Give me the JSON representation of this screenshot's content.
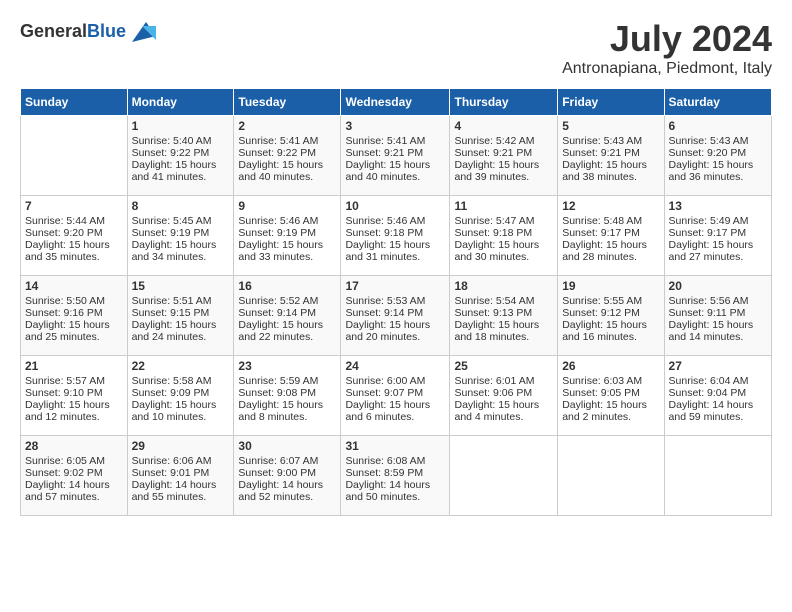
{
  "header": {
    "logo_general": "General",
    "logo_blue": "Blue",
    "month_title": "July 2024",
    "location": "Antronapiana, Piedmont, Italy"
  },
  "days_of_week": [
    "Sunday",
    "Monday",
    "Tuesday",
    "Wednesday",
    "Thursday",
    "Friday",
    "Saturday"
  ],
  "weeks": [
    [
      {
        "day": "",
        "sunrise": "",
        "sunset": "",
        "daylight": ""
      },
      {
        "day": "1",
        "sunrise": "Sunrise: 5:40 AM",
        "sunset": "Sunset: 9:22 PM",
        "daylight": "Daylight: 15 hours and 41 minutes."
      },
      {
        "day": "2",
        "sunrise": "Sunrise: 5:41 AM",
        "sunset": "Sunset: 9:22 PM",
        "daylight": "Daylight: 15 hours and 40 minutes."
      },
      {
        "day": "3",
        "sunrise": "Sunrise: 5:41 AM",
        "sunset": "Sunset: 9:21 PM",
        "daylight": "Daylight: 15 hours and 40 minutes."
      },
      {
        "day": "4",
        "sunrise": "Sunrise: 5:42 AM",
        "sunset": "Sunset: 9:21 PM",
        "daylight": "Daylight: 15 hours and 39 minutes."
      },
      {
        "day": "5",
        "sunrise": "Sunrise: 5:43 AM",
        "sunset": "Sunset: 9:21 PM",
        "daylight": "Daylight: 15 hours and 38 minutes."
      },
      {
        "day": "6",
        "sunrise": "Sunrise: 5:43 AM",
        "sunset": "Sunset: 9:20 PM",
        "daylight": "Daylight: 15 hours and 36 minutes."
      }
    ],
    [
      {
        "day": "7",
        "sunrise": "Sunrise: 5:44 AM",
        "sunset": "Sunset: 9:20 PM",
        "daylight": "Daylight: 15 hours and 35 minutes."
      },
      {
        "day": "8",
        "sunrise": "Sunrise: 5:45 AM",
        "sunset": "Sunset: 9:19 PM",
        "daylight": "Daylight: 15 hours and 34 minutes."
      },
      {
        "day": "9",
        "sunrise": "Sunrise: 5:46 AM",
        "sunset": "Sunset: 9:19 PM",
        "daylight": "Daylight: 15 hours and 33 minutes."
      },
      {
        "day": "10",
        "sunrise": "Sunrise: 5:46 AM",
        "sunset": "Sunset: 9:18 PM",
        "daylight": "Daylight: 15 hours and 31 minutes."
      },
      {
        "day": "11",
        "sunrise": "Sunrise: 5:47 AM",
        "sunset": "Sunset: 9:18 PM",
        "daylight": "Daylight: 15 hours and 30 minutes."
      },
      {
        "day": "12",
        "sunrise": "Sunrise: 5:48 AM",
        "sunset": "Sunset: 9:17 PM",
        "daylight": "Daylight: 15 hours and 28 minutes."
      },
      {
        "day": "13",
        "sunrise": "Sunrise: 5:49 AM",
        "sunset": "Sunset: 9:17 PM",
        "daylight": "Daylight: 15 hours and 27 minutes."
      }
    ],
    [
      {
        "day": "14",
        "sunrise": "Sunrise: 5:50 AM",
        "sunset": "Sunset: 9:16 PM",
        "daylight": "Daylight: 15 hours and 25 minutes."
      },
      {
        "day": "15",
        "sunrise": "Sunrise: 5:51 AM",
        "sunset": "Sunset: 9:15 PM",
        "daylight": "Daylight: 15 hours and 24 minutes."
      },
      {
        "day": "16",
        "sunrise": "Sunrise: 5:52 AM",
        "sunset": "Sunset: 9:14 PM",
        "daylight": "Daylight: 15 hours and 22 minutes."
      },
      {
        "day": "17",
        "sunrise": "Sunrise: 5:53 AM",
        "sunset": "Sunset: 9:14 PM",
        "daylight": "Daylight: 15 hours and 20 minutes."
      },
      {
        "day": "18",
        "sunrise": "Sunrise: 5:54 AM",
        "sunset": "Sunset: 9:13 PM",
        "daylight": "Daylight: 15 hours and 18 minutes."
      },
      {
        "day": "19",
        "sunrise": "Sunrise: 5:55 AM",
        "sunset": "Sunset: 9:12 PM",
        "daylight": "Daylight: 15 hours and 16 minutes."
      },
      {
        "day": "20",
        "sunrise": "Sunrise: 5:56 AM",
        "sunset": "Sunset: 9:11 PM",
        "daylight": "Daylight: 15 hours and 14 minutes."
      }
    ],
    [
      {
        "day": "21",
        "sunrise": "Sunrise: 5:57 AM",
        "sunset": "Sunset: 9:10 PM",
        "daylight": "Daylight: 15 hours and 12 minutes."
      },
      {
        "day": "22",
        "sunrise": "Sunrise: 5:58 AM",
        "sunset": "Sunset: 9:09 PM",
        "daylight": "Daylight: 15 hours and 10 minutes."
      },
      {
        "day": "23",
        "sunrise": "Sunrise: 5:59 AM",
        "sunset": "Sunset: 9:08 PM",
        "daylight": "Daylight: 15 hours and 8 minutes."
      },
      {
        "day": "24",
        "sunrise": "Sunrise: 6:00 AM",
        "sunset": "Sunset: 9:07 PM",
        "daylight": "Daylight: 15 hours and 6 minutes."
      },
      {
        "day": "25",
        "sunrise": "Sunrise: 6:01 AM",
        "sunset": "Sunset: 9:06 PM",
        "daylight": "Daylight: 15 hours and 4 minutes."
      },
      {
        "day": "26",
        "sunrise": "Sunrise: 6:03 AM",
        "sunset": "Sunset: 9:05 PM",
        "daylight": "Daylight: 15 hours and 2 minutes."
      },
      {
        "day": "27",
        "sunrise": "Sunrise: 6:04 AM",
        "sunset": "Sunset: 9:04 PM",
        "daylight": "Daylight: 14 hours and 59 minutes."
      }
    ],
    [
      {
        "day": "28",
        "sunrise": "Sunrise: 6:05 AM",
        "sunset": "Sunset: 9:02 PM",
        "daylight": "Daylight: 14 hours and 57 minutes."
      },
      {
        "day": "29",
        "sunrise": "Sunrise: 6:06 AM",
        "sunset": "Sunset: 9:01 PM",
        "daylight": "Daylight: 14 hours and 55 minutes."
      },
      {
        "day": "30",
        "sunrise": "Sunrise: 6:07 AM",
        "sunset": "Sunset: 9:00 PM",
        "daylight": "Daylight: 14 hours and 52 minutes."
      },
      {
        "day": "31",
        "sunrise": "Sunrise: 6:08 AM",
        "sunset": "Sunset: 8:59 PM",
        "daylight": "Daylight: 14 hours and 50 minutes."
      },
      {
        "day": "",
        "sunrise": "",
        "sunset": "",
        "daylight": ""
      },
      {
        "day": "",
        "sunrise": "",
        "sunset": "",
        "daylight": ""
      },
      {
        "day": "",
        "sunrise": "",
        "sunset": "",
        "daylight": ""
      }
    ]
  ]
}
